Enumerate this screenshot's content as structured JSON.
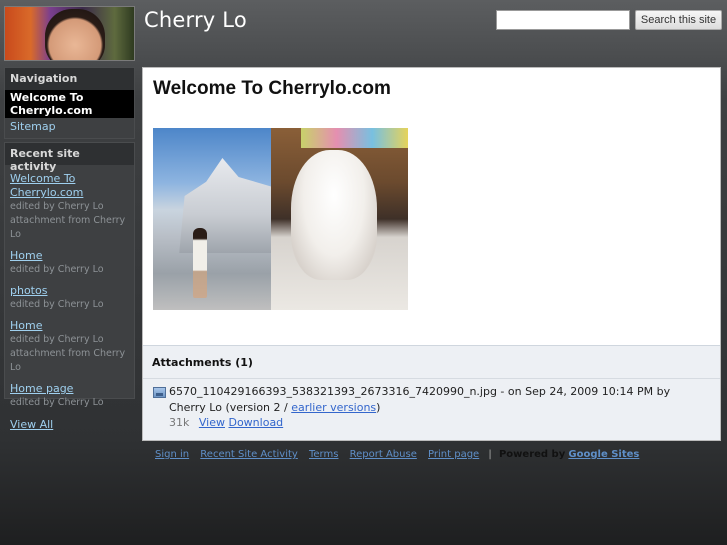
{
  "header": {
    "site_title": "Cherry Lo",
    "search": {
      "value": "",
      "placeholder": "",
      "button_label": "Search this site"
    }
  },
  "sidebar": {
    "navigation": {
      "heading": "Navigation",
      "current_page": "Welcome To Cherrylo.com",
      "items": [
        {
          "label": "Sitemap"
        }
      ]
    },
    "recent_activity": {
      "heading": "Recent site activity",
      "items": [
        {
          "title": "Welcome To Cherrylo.com",
          "meta1": "edited by Cherry Lo",
          "meta2": "attachment from Cherry Lo"
        },
        {
          "title": "Home",
          "meta1": "edited by Cherry Lo"
        },
        {
          "title": "photos",
          "meta1": "edited by Cherry Lo"
        },
        {
          "title": "Home",
          "meta1": "edited by Cherry Lo",
          "meta2": "attachment from Cherry Lo"
        },
        {
          "title": "Home page",
          "meta1": "edited by Cherry Lo"
        }
      ],
      "view_all_label": "View All"
    }
  },
  "main": {
    "page_title": "Welcome To Cherrylo.com",
    "attachments": {
      "heading": "Attachments (1)",
      "file": {
        "description_prefix": "6570_110429166393_538321393_2673316_7420990_n.jpg - on Sep 24, 2009 10:14 PM by Cherry Lo (version 2 / ",
        "versions_link": "earlier versions",
        "description_suffix": ")",
        "size": "31k",
        "view_label": "View",
        "download_label": "Download"
      }
    }
  },
  "footer": {
    "links": [
      "Sign in",
      "Recent Site Activity",
      "Terms",
      "Report Abuse",
      "Print page"
    ],
    "separator": "|",
    "powered_by": "Powered by",
    "google_sites": "Google Sites"
  },
  "colors": {
    "link": "#9fd0ef",
    "content_link": "#3366cc",
    "nav_selected_bg": "#000000"
  }
}
